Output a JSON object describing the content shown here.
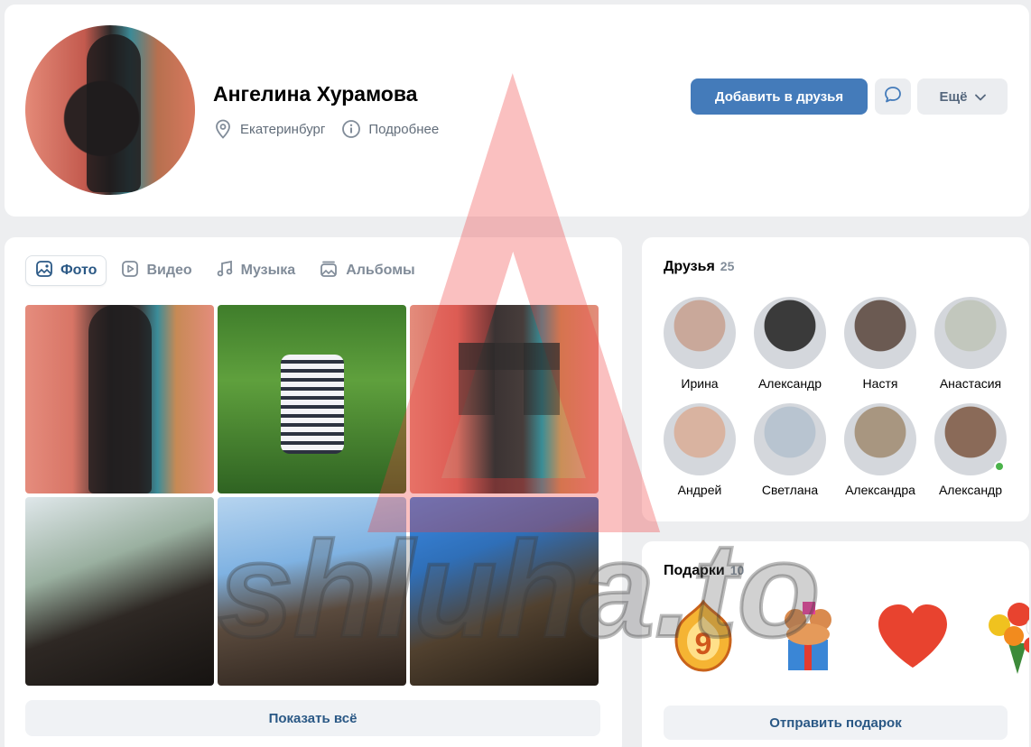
{
  "profile": {
    "name": "Ангелина Хурамова",
    "city": "Екатеринбург",
    "details_label": "Подробнее",
    "add_friend_label": "Добавить в друзья",
    "more_label": "Ещё"
  },
  "media": {
    "tabs": [
      {
        "label": "Фото",
        "icon": "photo-icon",
        "active": true
      },
      {
        "label": "Видео",
        "icon": "video-icon",
        "active": false
      },
      {
        "label": "Музыка",
        "icon": "music-icon",
        "active": false
      },
      {
        "label": "Альбомы",
        "icon": "albums-icon",
        "active": false
      }
    ],
    "show_all_label": "Показать всё"
  },
  "friends": {
    "title": "Друзья",
    "count": "25",
    "items": [
      {
        "name": "Ирина",
        "color": "#c9a89a"
      },
      {
        "name": "Александр",
        "color": "#3a3a3a"
      },
      {
        "name": "Настя",
        "color": "#6b5a52"
      },
      {
        "name": "Анастасия",
        "color": "#c2c7bd"
      },
      {
        "name": "Андрей",
        "color": "#d9b3a0"
      },
      {
        "name": "Светлана",
        "color": "#b8c4d0"
      },
      {
        "name": "Александра",
        "color": "#a89680"
      },
      {
        "name": "Александр",
        "color": "#8a6a58",
        "online": true
      }
    ]
  },
  "gifts": {
    "title": "Подарки",
    "count": "10",
    "send_label": "Отправить подарок"
  },
  "watermark": {
    "text": "shluha.to"
  }
}
